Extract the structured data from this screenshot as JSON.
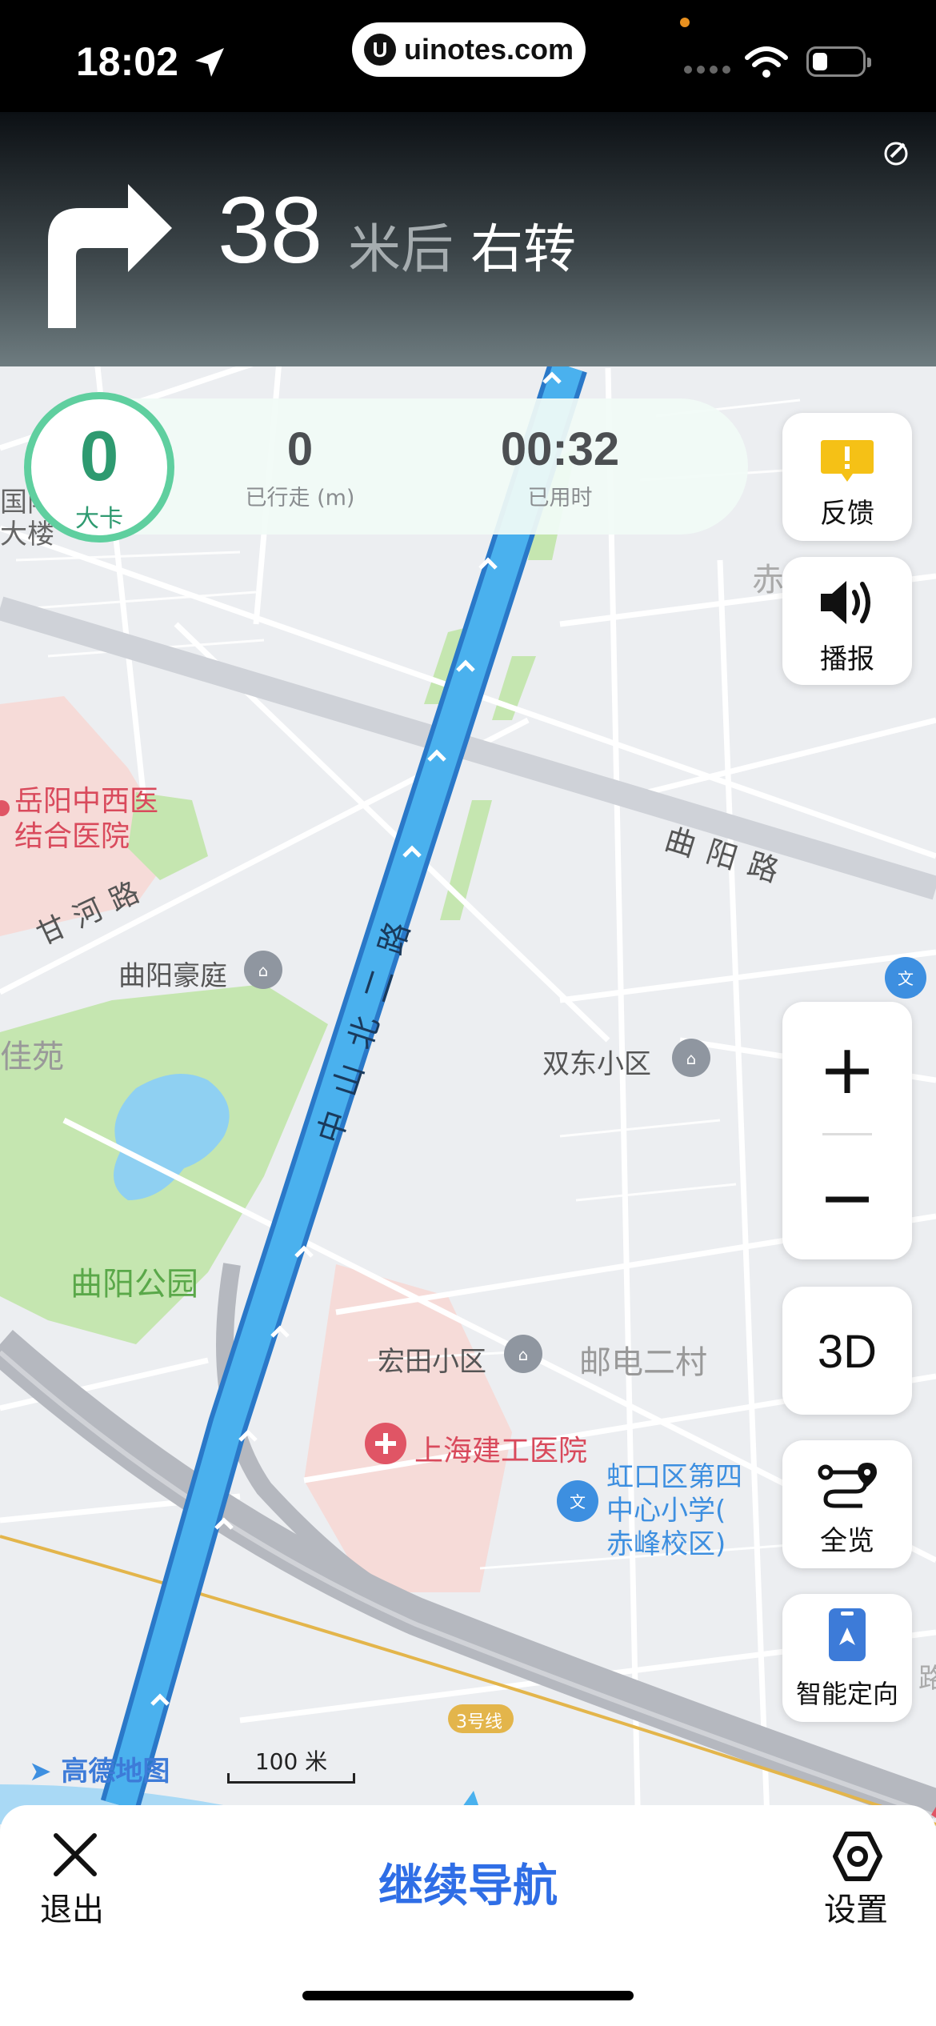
{
  "status_bar": {
    "time": "18:02",
    "url": "uinotes.com",
    "url_badge": "U"
  },
  "guidance": {
    "distance": "38",
    "unit": "米后",
    "direction": "右转",
    "turn_icon": "turn-right-arrow-icon"
  },
  "stats": {
    "speed_value": "0",
    "speed_unit": "大卡",
    "walked_value": "0",
    "walked_label": "已行走 (m)",
    "elapsed_value": "00:32",
    "elapsed_label": "已用时"
  },
  "right_controls": {
    "feedback_label": "反馈",
    "broadcast_label": "播报",
    "zoom_in": "+",
    "zoom_out": "−",
    "mode_3d": "3D",
    "overview_label": "全览",
    "smart_orient_label": "智能定向"
  },
  "map": {
    "labels": {
      "guoji": "国际",
      "dalou": "大楼",
      "chifeng": "赤峰小区",
      "hospital1_l1": "岳阳中西医",
      "hospital1_l2": "结合医院",
      "quyang_road": "曲阳路",
      "ganhe_road": "甘河路",
      "zhongshan_road": "中山北二路",
      "quyang_haoting": "曲阳豪庭",
      "jiayuan": "佳苑",
      "shuangdong": "双东小区",
      "quyang_park": "曲阳公园",
      "hongtian": "宏田小区",
      "youdian": "邮电二村",
      "hospital2": "上海建工医院",
      "school_l1": "虹口区第四",
      "school_l2": "中心小学(",
      "school_l3": "赤峰校区)",
      "metro_line": "3号线",
      "edge_partial": "路"
    },
    "logo": "高德地图",
    "scale_label": "100 米",
    "colors": {
      "route": "#4ab1ee",
      "route_border": "#2a78c8",
      "park": "#c5e6b0",
      "water": "#8fd0f2",
      "hospital_zone": "#f6dbd8",
      "road": "#ffffff",
      "elevated_road": "#b5b8bf"
    }
  },
  "bottom_bar": {
    "exit_label": "退出",
    "continue_label": "继续导航",
    "settings_label": "设置"
  }
}
